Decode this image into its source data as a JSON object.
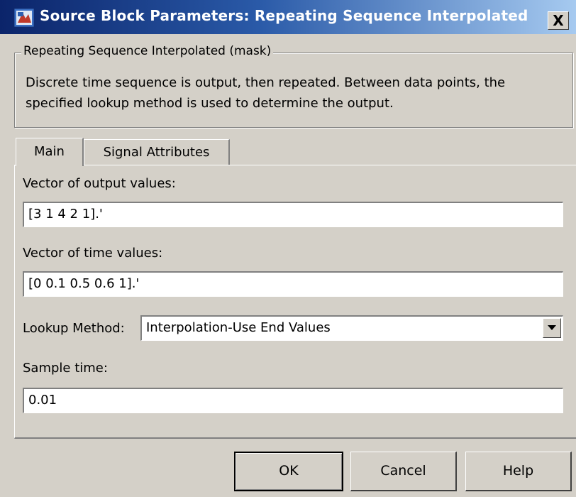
{
  "window": {
    "title": "Source Block Parameters: Repeating Sequence Interpolated",
    "close_label": "X"
  },
  "description": {
    "group_label": "Repeating Sequence Interpolated (mask)",
    "line1": "Discrete time sequence is output, then repeated.  Between data points, the",
    "line2": "specified lookup method is used to determine the output."
  },
  "tabs": [
    {
      "label": "Main",
      "selected": true
    },
    {
      "label": "Signal Attributes",
      "selected": false
    }
  ],
  "fields": {
    "output_values": {
      "label": "Vector of output values:",
      "value": "[3 1 4 2 1].'"
    },
    "time_values": {
      "label": "Vector of time values:",
      "value": "[0 0.1 0.5 0.6 1].'"
    },
    "lookup_method": {
      "label": "Lookup Method:",
      "value": "Interpolation-Use End Values"
    },
    "sample_time": {
      "label": "Sample time:",
      "value": "0.01"
    }
  },
  "buttons": {
    "ok": "OK",
    "cancel": "Cancel",
    "help": "Help"
  }
}
